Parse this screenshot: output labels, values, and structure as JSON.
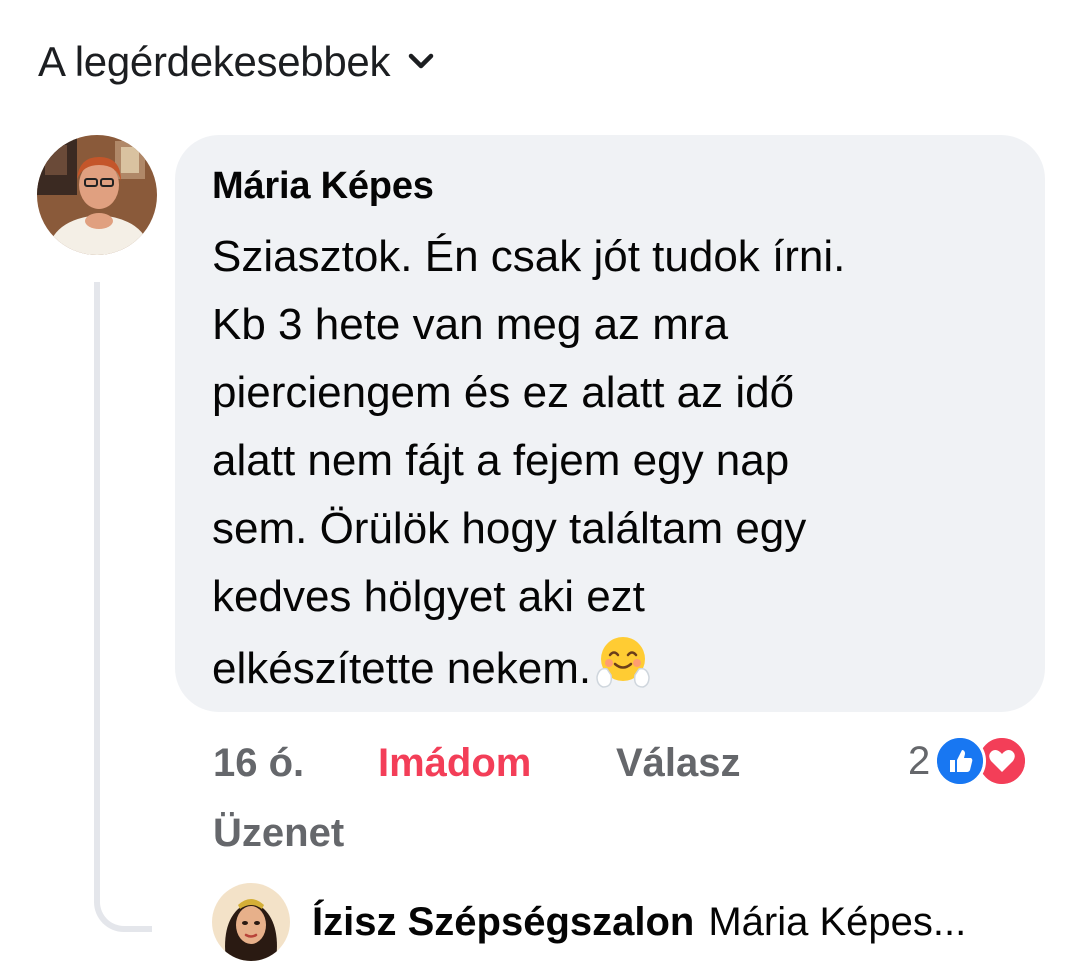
{
  "sort": {
    "label": "A legérdekesebbek",
    "icon": "chevron-down-icon"
  },
  "comment": {
    "author": "Mária Képes",
    "lines": [
      "Sziasztok. Én csak jót tudok írni.",
      "Kb 3 hete van meg az mra",
      "pierciengem és ez alatt az idő",
      "alatt nem fájt a fejem egy nap",
      "sem. Örülök hogy találtam egy",
      "kedves hölgyet aki ezt",
      "elkészítette nekem."
    ],
    "emoji": "hugging-face-emoji",
    "time": "16 ó.",
    "love_label": "Imádom",
    "reply_label": "Válasz",
    "message_label": "Üzenet",
    "reaction_count": "2",
    "reactions": [
      "like-icon",
      "love-icon"
    ]
  },
  "reply_preview": {
    "author": "Ízisz Szépségszalon",
    "snippet": "Mária Képes..."
  },
  "colors": {
    "bubble_bg": "#f0f2f5",
    "love_red": "#f33e58",
    "like_blue": "#1877f2",
    "meta_gray": "#65676b",
    "thread_line": "#e4e6eb"
  }
}
